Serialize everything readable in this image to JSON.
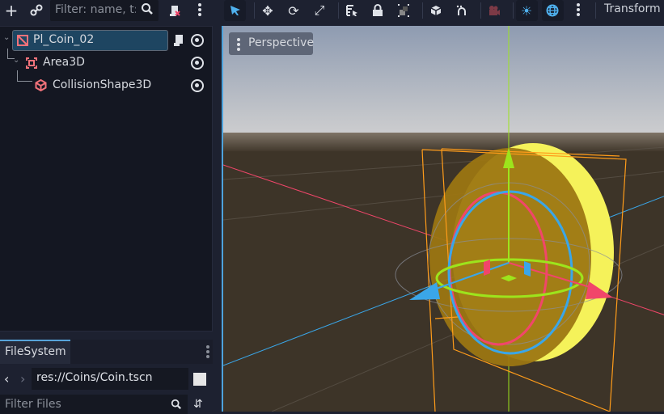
{
  "scene_dock": {
    "toolbar": {
      "add_node_icon": "plus-icon",
      "instance_icon": "link-icon",
      "filter_placeholder": "Filter: name, t:t",
      "search_icon": "search-icon",
      "script_icon": "script-remove-icon",
      "menu_icon": "kebab-menu-icon"
    },
    "tree": [
      {
        "name": "Pl_Coin_02",
        "icon": "node3d-icon",
        "depth": 0,
        "selected": true,
        "expanded": true,
        "has_script": true,
        "visible": true
      },
      {
        "name": "Area3D",
        "icon": "area3d-icon",
        "depth": 1,
        "selected": false,
        "expanded": true,
        "has_script": false,
        "visible": true
      },
      {
        "name": "CollisionShape3D",
        "icon": "collision-shape-icon",
        "depth": 2,
        "selected": false,
        "expanded": false,
        "has_script": false,
        "visible": true
      }
    ]
  },
  "filesystem": {
    "tab_label": "FileSystem",
    "path": "res://Coins/Coin.tscn",
    "filter_placeholder": "Filter Files"
  },
  "main_toolbar": {
    "tools": [
      "select",
      "move",
      "rotate",
      "scale",
      "list-select",
      "lock",
      "group",
      "local-space",
      "snap",
      "camera",
      "sun-preview",
      "environment-preview",
      "more"
    ],
    "transform_menu": "Transform"
  },
  "viewport": {
    "perspective_label": "Perspective",
    "colors": {
      "x_axis": "#f1466a",
      "y_axis": "#9de41c",
      "z_axis": "#3aa6e8",
      "selection_box": "#ff9c1a",
      "coin": "#d4a10f",
      "accent": "#57a3d9"
    }
  }
}
